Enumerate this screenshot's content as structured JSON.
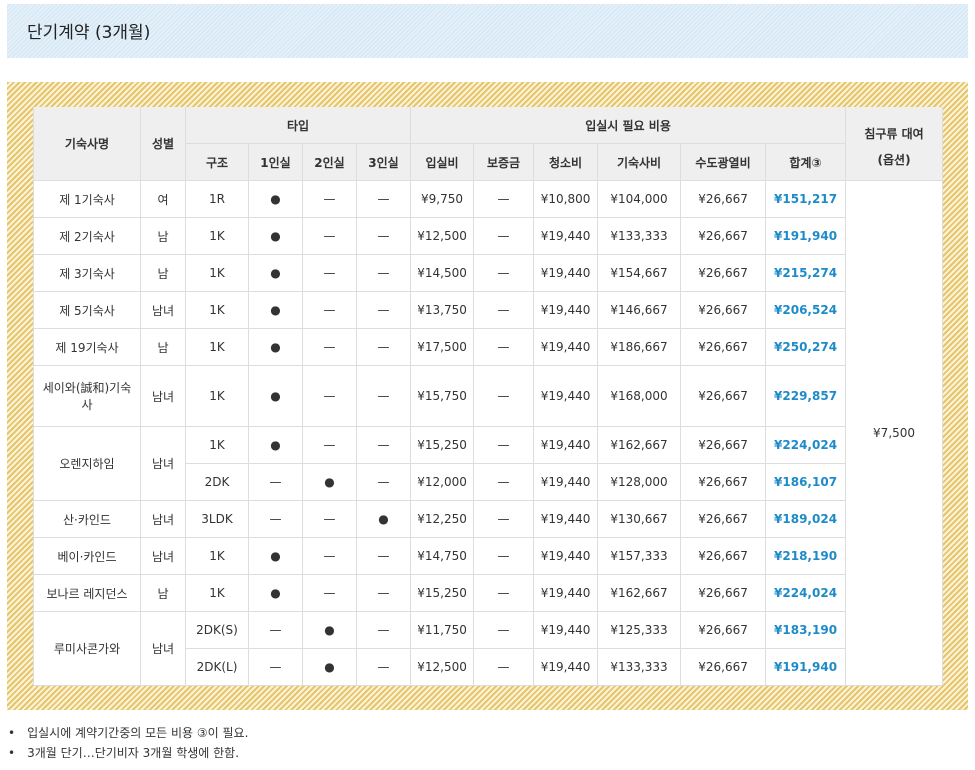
{
  "title": "단기계약 (3개월)",
  "headers": {
    "name": "기숙사명",
    "gender": "성별",
    "type": "타입",
    "costs": "입실시 필요 비용",
    "bedding": "침구류 대여",
    "bedding_sub": "(옵션)",
    "sub": [
      "구조",
      "1인실",
      "2인실",
      "3인실",
      "입실비",
      "보증금",
      "청소비",
      "기숙사비",
      "수도광열비",
      "합계③"
    ]
  },
  "bedding_price": "¥7,500",
  "dorms": [
    {
      "name": "제 1기숙사",
      "gender": "여",
      "units": [
        [
          "1R",
          "●",
          "—",
          "—",
          "¥9,750",
          "—",
          "¥10,800",
          "¥104,000",
          "¥26,667",
          "¥151,217"
        ]
      ]
    },
    {
      "name": "제 2기숙사",
      "gender": "남",
      "units": [
        [
          "1K",
          "●",
          "—",
          "—",
          "¥12,500",
          "—",
          "¥19,440",
          "¥133,333",
          "¥26,667",
          "¥191,940"
        ]
      ]
    },
    {
      "name": "제 3기숙사",
      "gender": "남",
      "units": [
        [
          "1K",
          "●",
          "—",
          "—",
          "¥14,500",
          "—",
          "¥19,440",
          "¥154,667",
          "¥26,667",
          "¥215,274"
        ]
      ]
    },
    {
      "name": "제 5기숙사",
      "gender": "남녀",
      "units": [
        [
          "1K",
          "●",
          "—",
          "—",
          "¥13,750",
          "—",
          "¥19,440",
          "¥146,667",
          "¥26,667",
          "¥206,524"
        ]
      ]
    },
    {
      "name": "제 19기숙사",
      "gender": "남",
      "units": [
        [
          "1K",
          "●",
          "—",
          "—",
          "¥17,500",
          "—",
          "¥19,440",
          "¥186,667",
          "¥26,667",
          "¥250,274"
        ]
      ]
    },
    {
      "name": "세이와(誠和)기숙사",
      "gender": "남녀",
      "tall": true,
      "units": [
        [
          "1K",
          "●",
          "—",
          "—",
          "¥15,750",
          "—",
          "¥19,440",
          "¥168,000",
          "¥26,667",
          "¥229,857"
        ]
      ]
    },
    {
      "name": "오렌지하임",
      "gender": "남녀",
      "units": [
        [
          "1K",
          "●",
          "—",
          "—",
          "¥15,250",
          "—",
          "¥19,440",
          "¥162,667",
          "¥26,667",
          "¥224,024"
        ],
        [
          "2DK",
          "—",
          "●",
          "—",
          "¥12,000",
          "—",
          "¥19,440",
          "¥128,000",
          "¥26,667",
          "¥186,107"
        ]
      ]
    },
    {
      "name": "산·카인드",
      "gender": "남녀",
      "units": [
        [
          "3LDK",
          "—",
          "—",
          "●",
          "¥12,250",
          "—",
          "¥19,440",
          "¥130,667",
          "¥26,667",
          "¥189,024"
        ]
      ]
    },
    {
      "name": "베이·카인드",
      "gender": "남녀",
      "units": [
        [
          "1K",
          "●",
          "—",
          "—",
          "¥14,750",
          "—",
          "¥19,440",
          "¥157,333",
          "¥26,667",
          "¥218,190"
        ]
      ]
    },
    {
      "name": "보나르 레지던스",
      "gender": "남",
      "units": [
        [
          "1K",
          "●",
          "—",
          "—",
          "¥15,250",
          "—",
          "¥19,440",
          "¥162,667",
          "¥26,667",
          "¥224,024"
        ]
      ]
    },
    {
      "name": "루미사콘가와",
      "gender": "남녀",
      "units": [
        [
          "2DK(S)",
          "—",
          "●",
          "—",
          "¥11,750",
          "—",
          "¥19,440",
          "¥125,333",
          "¥26,667",
          "¥183,190"
        ],
        [
          "2DK(L)",
          "—",
          "●",
          "—",
          "¥12,500",
          "—",
          "¥19,440",
          "¥133,333",
          "¥26,667",
          "¥191,940"
        ]
      ]
    }
  ],
  "notes": [
    "입실시에 계약기간중의 모든 비용 ③이 필요.",
    "3개월 단기…단기비자 3개월 학생에 한함."
  ]
}
